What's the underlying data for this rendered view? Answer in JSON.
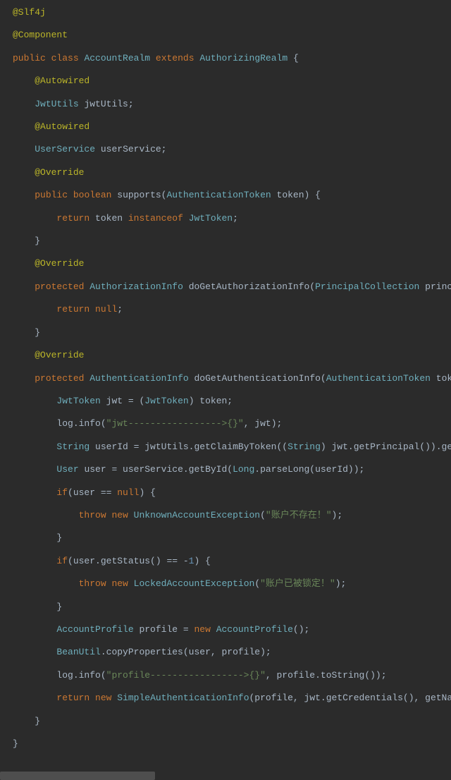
{
  "code": {
    "ann_slf4j": "@Slf4j",
    "ann_component": "@Component",
    "kw_public": "public",
    "kw_class": "class",
    "cls_AccountRealm": "AccountRealm",
    "kw_extends": "extends",
    "cls_AuthorizingRealm": "AuthorizingRealm",
    "lb": "{",
    "rb": "}",
    "ann_autowired": "@Autowired",
    "typ_JwtUtils": "JwtUtils",
    "id_jwtUtils": "jwtUtils;",
    "typ_UserService": "UserService",
    "id_userService": "userService;",
    "ann_override": "@Override",
    "kw_boolean": "boolean",
    "fn_supports": "supports(",
    "typ_AuthenticationToken": "AuthenticationToken",
    "p_token": " token) {",
    "kw_return": "return",
    "id_token": "token",
    "kw_instanceof": "instanceof",
    "typ_JwtToken": "JwtToken",
    "semi": ";",
    "kw_protected": "protected",
    "typ_AuthorizationInfo": "AuthorizationInfo",
    "fn_doGetAuthz": "doGetAuthorizationInfo(",
    "typ_PrincipalCollection": "PrincipalCollection",
    "p_principals": " principals",
    "kw_null": "null",
    "typ_AuthenticationInfo": "AuthenticationInfo",
    "fn_doGetAuthn": "doGetAuthenticationInfo(",
    "p_token2": " token) t",
    "seg_jwt_assign": " jwt = (",
    "seg_token_end": ") token;",
    "seg_loginfo": "log.info(",
    "str_jwt": "\"jwt----------------->{}\"",
    "seg_jwtend": ", jwt);",
    "typ_String": "String",
    "seg_userId": " userId = jwtUtils.getClaimByToken((",
    "seg_userId2": ") jwt.getPrincipal()).getSubj",
    "typ_User": "User",
    "seg_user": " user = userService.getById(",
    "typ_Long": "Long",
    "seg_user2": ".parseLong(userId));",
    "kw_if": "if",
    "seg_ifuser": "(user == ",
    "seg_ifuser2": ") {",
    "kw_throw": "throw",
    "kw_new": "new",
    "typ_UnknownAccountException": "UnknownAccountException",
    "str_noaccount": "\"账户不存在！\"",
    "seg_exc_end": ");",
    "seg_ifstatus": "(user.getStatus() == -",
    "num_1": "1",
    "seg_ifstatus2": ") {",
    "typ_LockedAccountException": "LockedAccountException",
    "str_locked": "\"账户已被锁定！\"",
    "typ_AccountProfile": "AccountProfile",
    "seg_profile": " profile = ",
    "seg_profile2": "();",
    "typ_BeanUtil": "BeanUtil",
    "seg_bean": ".copyProperties(user, profile);",
    "str_profile": "\"profile----------------->{}\"",
    "seg_profile_end": ", profile.toString());",
    "typ_SimpleAuthenticationInfo": "SimpleAuthenticationInfo",
    "seg_sai": "(profile, jwt.getCredentials(), getName())"
  }
}
